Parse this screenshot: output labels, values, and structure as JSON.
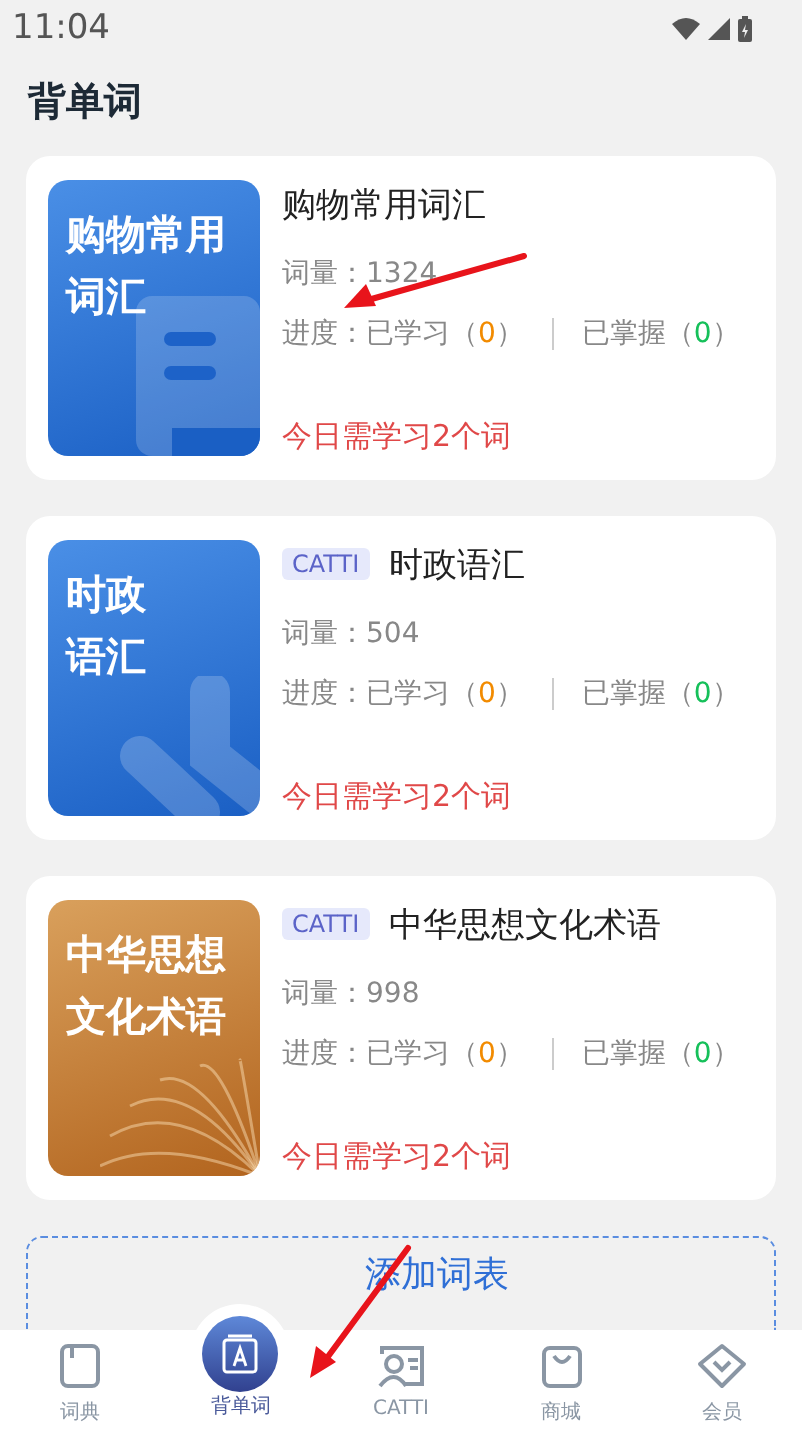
{
  "status_bar": {
    "time": "11:04"
  },
  "title": "背单词",
  "books": [
    {
      "kind": "document",
      "cover_lines": [
        "购物常用",
        "词汇"
      ],
      "name": "购物常用词汇",
      "count": "词量：1324",
      "progress_label": "进度：",
      "learned_label": "已学习（",
      "learned_count": "0",
      "learned_close": "）",
      "mastered_label": "已掌握（",
      "mastered_count": "0",
      "mastered_close": "）",
      "today": "今日需学习2个词"
    },
    {
      "kind": "ribbon",
      "tag": "CATTI",
      "cover_lines": [
        "时政",
        "语汇"
      ],
      "name": "时政语汇",
      "count": "词量：504",
      "progress_label": "进度：",
      "learned_label": "已学习（",
      "learned_count": "0",
      "learned_close": "）",
      "mastered_label": "已掌握（",
      "mastered_count": "0",
      "mastered_close": "）",
      "today": "今日需学习2个词"
    },
    {
      "kind": "book",
      "tag": "CATTI",
      "cover_lines": [
        "中华思想",
        "文化术语"
      ],
      "name": "中华思想文化术语",
      "count": "词量：998",
      "progress_label": "进度：",
      "learned_label": "已学习（",
      "learned_count": "0",
      "learned_close": "）",
      "mastered_label": "已掌握（",
      "mastered_count": "0",
      "mastered_close": "）",
      "today": "今日需学习2个词"
    }
  ],
  "add_button": "添加词表",
  "tabs": [
    {
      "kind": "dictionary",
      "label": "词典",
      "selected": false
    },
    {
      "kind": "vocabulary",
      "label": "背单词",
      "selected": true
    },
    {
      "kind": "catti",
      "label": "CATTI",
      "selected": false
    },
    {
      "kind": "shop",
      "label": "商城",
      "selected": false
    },
    {
      "kind": "member",
      "label": "会员",
      "selected": false
    }
  ]
}
